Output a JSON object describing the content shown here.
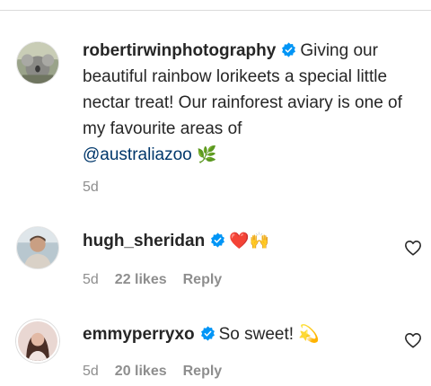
{
  "comments": [
    {
      "username": "robertirwinphotography",
      "text_before_mention": "Giving our beautiful rainbow lorikeets a special little nectar treat! Our rainforest aviary is one of my favourite areas of",
      "mention": "@australiazoo",
      "emoji": "🌿",
      "time": "5d"
    },
    {
      "username": "hugh_sheridan",
      "text": "❤️🙌",
      "time": "5d",
      "likes": "22 likes",
      "reply_label": "Reply"
    },
    {
      "username": "emmyperryxo",
      "text": "So sweet! 💫",
      "time": "5d",
      "likes": "20 likes",
      "reply_label": "Reply"
    }
  ],
  "colors": {
    "verified_blue": "#0095f6",
    "mention_blue": "#00376b",
    "muted_gray": "#8e8e8e"
  },
  "icons": {
    "verified": "verified-badge-icon",
    "like": "heart-outline-icon"
  }
}
